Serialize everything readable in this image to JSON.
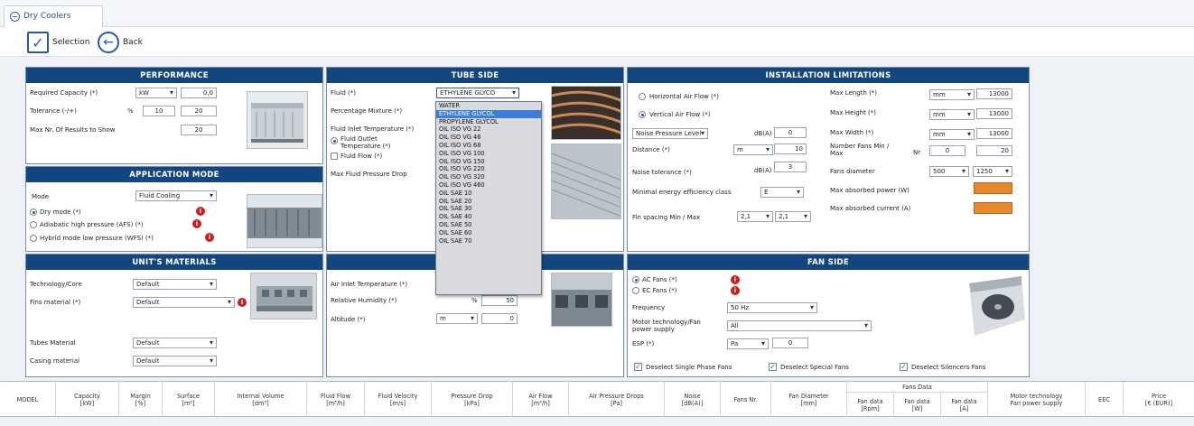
{
  "tab": {
    "title": "Dry Coolers"
  },
  "toolbar": {
    "selection": "Selection",
    "back": "Back"
  },
  "performance": {
    "title": "PERFORMANCE",
    "capacity_label": "Required Capacity (*)",
    "capacity_unit": "kW",
    "capacity_value": "0,0",
    "tolerance_label": "Tolerance (-/+)",
    "tolerance_unit": "%",
    "tolerance_min": "10",
    "tolerance_max": "20",
    "maxnr_label": "Max Nr. Of Results to Show",
    "maxnr_value": "20"
  },
  "application": {
    "title": "APPLICATION MODE",
    "mode_label": "Mode",
    "mode_value": "Fluid Cooling",
    "opt_dry": "Dry mode (*)",
    "opt_adiabatic": "Adiabatic high pressure (AFS) (*)",
    "opt_hybrid": "Hybrid mode low pressure (WFS) (*)"
  },
  "materials": {
    "title": "UNIT'S MATERIALS",
    "tech_label": "Technology/Core",
    "tech_value": "Default",
    "fins_label": "Fins material (*)",
    "fins_value": "Default",
    "tubes_label": "Tubes Material",
    "tubes_value": "Default",
    "casing_label": "Casing material",
    "casing_value": "Default"
  },
  "tube": {
    "title": "TUBE SIDE",
    "fluid_label": "Fluid (*)",
    "fluid_value": "ETHYLENE GLYCO",
    "mixture_label": "Percentage Mixture (*)",
    "inlet_label": "Fluid Inlet Temperature (*)",
    "outlet_label": "Fluid Outlet Temperature (*)",
    "flow_label": "Fluid Flow (*)",
    "pressure_label": "Max Fluid Pressure Drop",
    "options": [
      "WATER",
      "ETHYLENE GLYCOL",
      "PROPYLENE GLYCOL",
      "OIL ISO VG 22",
      "OIL ISO VG 46",
      "OIL ISO VG 68",
      "OIL ISO VG 100",
      "OIL ISO VG 150",
      "OIL ISO VG 220",
      "OIL ISO VG 320",
      "OIL ISO VG 460",
      "OIL SAE 10",
      "OIL SAE 20",
      "OIL SAE 30",
      "OIL SAE 40",
      "OIL SAE 50",
      "OIL SAE 60",
      "OIL SAE 70"
    ]
  },
  "air": {
    "inlet_label": "Air Inlet Temperature (*)",
    "humidity_label": "Relative Humidity (*)",
    "humidity_unit": "%",
    "humidity_value": "50",
    "altitude_label": "Altitude (*)",
    "altitude_unit": "m",
    "altitude_value": "0"
  },
  "install": {
    "title": "INSTALLATION LIMITATIONS",
    "horizontal": "Horizontal Air Flow (*)",
    "vertical": "Vertical Air Flow (*)",
    "noise_type": "Noise Pressure Level",
    "noise_unit": "dB(A)",
    "noise_value": "0",
    "distance_label": "Distance (*)",
    "distance_unit": "m",
    "distance_value": "10",
    "tolerance_label": "Noise tolerance (*)",
    "tolerance_unit": "dB(A)",
    "tolerance_value": "3",
    "eff_label": "Minimal energy efficiency class",
    "eff_value": "E",
    "fin_label": "Fin spacing Min / Max",
    "fin_min": "2,1",
    "fin_max": "2,1",
    "len_label": "Max Length (*)",
    "len_unit": "mm",
    "len_value": "13000",
    "height_label": "Max Height (*)",
    "height_unit": "mm",
    "height_value": "13000",
    "width_label": "Max Width (*)",
    "width_unit": "mm",
    "width_value": "13000",
    "fans_label": "Number Fans Min / Max",
    "fans_unit": "Nr",
    "fans_min": "0",
    "fans_max": "20",
    "diam_label": "Fans diameter",
    "diam_min": "500",
    "diam_max": "1250",
    "power_label": "Max absorbed power (W)",
    "current_label": "Max absorbed current (A)",
    "swatch_color": "#e58a2c"
  },
  "fan": {
    "title": "FAN SIDE",
    "ac": "AC Fans (*)",
    "ec": "EC Fans (*)",
    "freq_label": "Frequency",
    "freq_value": "50 Hz",
    "motor_label": "Motor technology/Fan power supply",
    "motor_value": "All",
    "esp_label": "ESP (*)",
    "esp_unit": "Pa",
    "esp_value": "0",
    "deselect_single": "Deselect Single Phase Fans",
    "deselect_special": "Deselect Special Fans",
    "deselect_silencers": "Deselect Silencers Fans"
  },
  "grid": {
    "model": "MODEL",
    "capacity": [
      "Capacity",
      "[kW]"
    ],
    "margin": [
      "Margin",
      "[%]"
    ],
    "surface": [
      "Surface",
      "[m²]"
    ],
    "volume": [
      "Internal Volume",
      "[dm³]"
    ],
    "fluidflow": [
      "Fluid Flow",
      "[m³/h]"
    ],
    "velocity": [
      "Fluid Velocity",
      "[m/s]"
    ],
    "pdrop": [
      "Pressure Drop",
      "[kPa]"
    ],
    "airflow": [
      "Air Flow",
      "[m³/h]"
    ],
    "airpdrop": [
      "Air Pressure Drops",
      "[Pa]"
    ],
    "noise": [
      "Noise",
      "[dB(A)]"
    ],
    "fansnr": "Fans Nr.",
    "fandiam": [
      "Fan Diameter",
      "[mm]"
    ],
    "fansdata": "Fans Data",
    "rpm": [
      "Fan data",
      "[Rpm]"
    ],
    "w": [
      "Fan data",
      "[W]"
    ],
    "a": [
      "Fan data",
      "[A]"
    ],
    "motor": [
      "Motor technology",
      "Fan power supply"
    ],
    "eec": "EEC",
    "price": [
      "Price",
      "[€ (EUR)]"
    ]
  }
}
